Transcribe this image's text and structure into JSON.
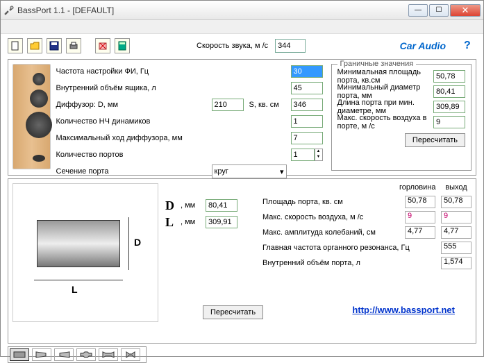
{
  "window": {
    "title": "BassPort 1.1 - [DEFAULT]"
  },
  "toolbar": {
    "speed_label": "Скорость звука, м /с",
    "speed_value": "344",
    "car_audio": "Car Audio",
    "help": "?"
  },
  "params": {
    "tuning_freq_label": "Частота настройки ФИ, Гц",
    "tuning_freq": "30",
    "box_volume_label": "Внутренний объём ящика, л",
    "box_volume": "45",
    "diffuser_label": "Диффузор: D, мм",
    "diffuser_d": "210",
    "s_label": "S, кв. см",
    "s_value": "346",
    "woofer_count_label": "Количество НЧ динамиков",
    "woofer_count": "1",
    "max_excursion_label": "Максимальный ход диффузора, мм",
    "max_excursion": "7",
    "port_count_label": "Количество портов",
    "port_count": "1",
    "port_shape_label": "Сечение порта",
    "port_shape": "круг"
  },
  "limits": {
    "legend": "Граничные значения",
    "min_area_label": "Минимальная площадь порта, кв.см",
    "min_area": "50,78",
    "min_diam_label": "Минимальный диаметр порта, мм",
    "min_diam": "80,41",
    "min_length_label": "Длина порта при мин. диаметре, мм",
    "min_length": "309,89",
    "max_air_label": "Макс. скорость воздуха в порте, м /с",
    "max_air": "9",
    "recalc": "Пересчитать"
  },
  "mid": {
    "D_unit": ", мм",
    "D_val": "80,41",
    "L_unit": ", мм",
    "L_val": "309,91"
  },
  "results": {
    "hdr_throat": "горловина",
    "hdr_exit": "выход",
    "area_label": "Площадь порта, кв. см",
    "area_t": "50,78",
    "area_e": "50,78",
    "air_label": "Макс. скорость воздуха, м /с",
    "air_t": "9",
    "air_e": "9",
    "amp_label": "Макс. амплитуда колебаний, см",
    "amp_t": "4,77",
    "amp_e": "4,77",
    "organ_label": "Главная частота органного резонанса, Гц",
    "organ": "555",
    "portvol_label": "Внутренний объём порта, л",
    "portvol": "1,574",
    "recalc": "Пересчитать",
    "url": "http://www.bassport.net"
  }
}
